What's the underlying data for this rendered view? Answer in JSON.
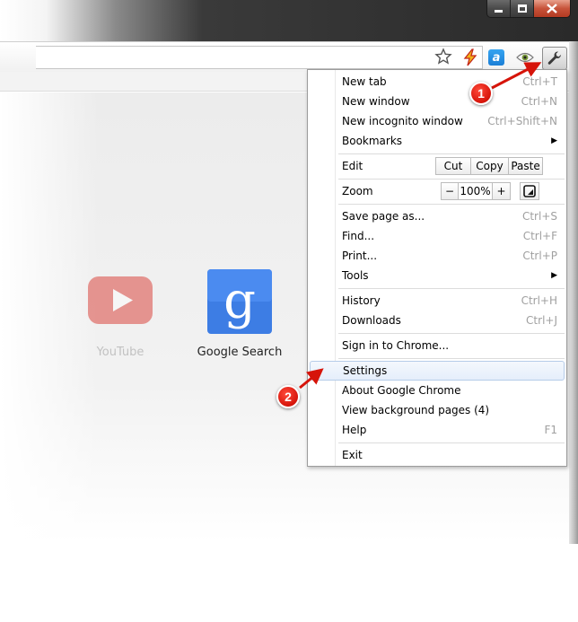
{
  "window": {
    "controls": [
      "minimize",
      "maximize",
      "close"
    ]
  },
  "toolbar": {
    "icons": [
      "star-icon",
      "bolt-extension-icon",
      "a-extension-icon",
      "eye-extension-icon",
      "wrench-icon"
    ],
    "a_extension_glyph": "a"
  },
  "apps": [
    {
      "label": "YouTube",
      "icon": "youtube-icon"
    },
    {
      "label": "Google Search",
      "icon": "google-search-icon"
    }
  ],
  "menu": {
    "items": {
      "new_tab": {
        "label": "New tab",
        "shortcut": "Ctrl+T"
      },
      "new_window": {
        "label": "New window",
        "shortcut": "Ctrl+N"
      },
      "new_incognito": {
        "label": "New incognito window",
        "shortcut": "Ctrl+Shift+N"
      },
      "bookmarks": {
        "label": "Bookmarks"
      },
      "edit": {
        "label": "Edit",
        "cut": "Cut",
        "copy": "Copy",
        "paste": "Paste"
      },
      "zoom": {
        "label": "Zoom",
        "minus": "−",
        "level": "100%",
        "plus": "+"
      },
      "save_page": {
        "label": "Save page as...",
        "shortcut": "Ctrl+S"
      },
      "find": {
        "label": "Find...",
        "shortcut": "Ctrl+F"
      },
      "print": {
        "label": "Print...",
        "shortcut": "Ctrl+P"
      },
      "tools": {
        "label": "Tools"
      },
      "history": {
        "label": "History",
        "shortcut": "Ctrl+H"
      },
      "downloads": {
        "label": "Downloads",
        "shortcut": "Ctrl+J"
      },
      "sign_in": {
        "label": "Sign in to Chrome..."
      },
      "settings": {
        "label": "Settings"
      },
      "about": {
        "label": "About Google Chrome"
      },
      "background_pages": {
        "label": "View background pages (4)"
      },
      "help": {
        "label": "Help",
        "shortcut": "F1"
      },
      "exit": {
        "label": "Exit"
      }
    }
  },
  "callouts": [
    {
      "number": "1",
      "target": "wrench-button"
    },
    {
      "number": "2",
      "target": "menu-item-settings"
    }
  ],
  "colors": {
    "callout": "#d6140a",
    "highlight_border": "#b6cce9",
    "shortcut_text": "#a0a0a0"
  }
}
